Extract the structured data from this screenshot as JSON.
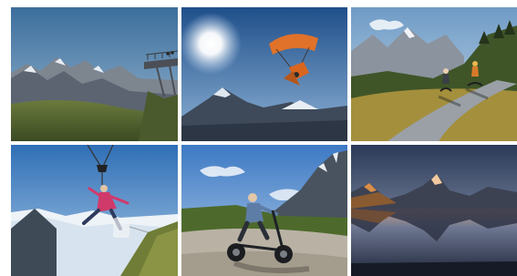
{
  "gallery": {
    "tiles": [
      {
        "subject": "cliff-walk-viewing-platform"
      },
      {
        "subject": "paraglider-with-sun"
      },
      {
        "subject": "mountain-cart-riders-on-road"
      },
      {
        "subject": "zipline-rider"
      },
      {
        "subject": "trottibike-rider"
      },
      {
        "subject": "alpine-lake-reflection-at-dusk"
      }
    ]
  }
}
